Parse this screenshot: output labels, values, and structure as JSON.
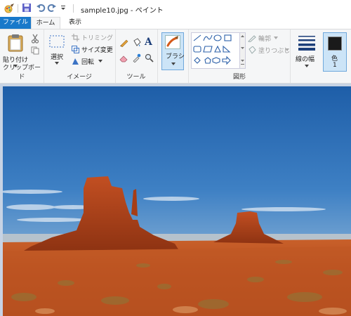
{
  "window": {
    "title": "sample10.jpg - ペイント"
  },
  "tabs": {
    "file": "ファイル",
    "home": "ホーム",
    "view": "表示"
  },
  "clipboard": {
    "paste": "貼り付け",
    "group": "クリップボード"
  },
  "image": {
    "select": "選択",
    "crop": "トリミング",
    "resize": "サイズ変更",
    "rotate": "回転",
    "group": "イメージ"
  },
  "tools": {
    "group": "ツール"
  },
  "brush": {
    "label": "ブラシ"
  },
  "shapes": {
    "outline": "輪郭",
    "fill": "塗りつぶし",
    "group": "図形"
  },
  "size": {
    "label": "線の幅"
  },
  "color1": {
    "label": "色",
    "number": "1",
    "value": "#1a1a1a"
  },
  "colors": {
    "accent": "#1979ca",
    "ribbon_bg": "#f5f6f7",
    "canvas_bg": "#c7d3e4"
  }
}
